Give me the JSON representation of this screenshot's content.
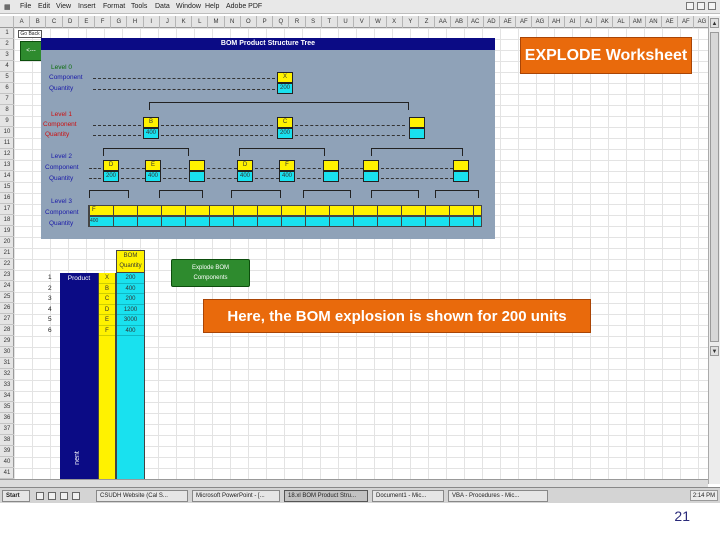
{
  "menubar": {
    "items": [
      "File",
      "Edit",
      "View",
      "Insert",
      "Format",
      "Tools",
      "Data",
      "Window",
      "Help",
      "Adobe PDF"
    ]
  },
  "columns": [
    "A",
    "B",
    "C",
    "D",
    "E",
    "F",
    "G",
    "H",
    "I",
    "J",
    "K",
    "L",
    "M",
    "N",
    "O",
    "P",
    "Q",
    "R",
    "S",
    "T",
    "U",
    "V",
    "W",
    "X",
    "Y",
    "Z",
    "AA",
    "AB",
    "AC",
    "AD",
    "AE",
    "AF",
    "AG",
    "AH",
    "AI",
    "AJ",
    "AK",
    "AL",
    "AM",
    "AN",
    "AE",
    "AF",
    "AG"
  ],
  "rows": [
    "1",
    "2",
    "3",
    "4",
    "5",
    "6",
    "7",
    "8",
    "9",
    "10",
    "11",
    "12",
    "13",
    "14",
    "15",
    "16",
    "17",
    "18",
    "19",
    "20",
    "21",
    "22",
    "23",
    "24",
    "25",
    "26",
    "27",
    "28",
    "29",
    "30",
    "31",
    "32",
    "33",
    "34",
    "35",
    "36",
    "37",
    "38",
    "39",
    "40",
    "41"
  ],
  "sheet": {
    "cell_ref": "Go Back",
    "back_button": "<---"
  },
  "bom_tree": {
    "title": "BOM Product Structure Tree",
    "level0": {
      "label": "Level 0",
      "component": "Component",
      "quantity": "Quantity",
      "comp_value": "X",
      "qty_value": "200"
    },
    "level1": {
      "label": "Level 1",
      "component": "Component",
      "quantity": "Quantity",
      "boxes": [
        {
          "comp": "B",
          "qty": "400"
        },
        {
          "comp": "C",
          "qty": "200"
        },
        {
          "comp": "",
          "qty": ""
        }
      ]
    },
    "level2": {
      "label": "Level 2",
      "component": "Component",
      "quantity": "Quantity",
      "boxes": [
        {
          "comp": "D",
          "qty": "200"
        },
        {
          "comp": "E",
          "qty": "400"
        },
        {
          "comp": "",
          "qty": ""
        },
        {
          "comp": "D",
          "qty": "400"
        },
        {
          "comp": "F",
          "qty": "400"
        },
        {
          "comp": "",
          "qty": ""
        },
        {
          "comp": "",
          "qty": ""
        },
        {
          "comp": "",
          "qty": ""
        }
      ]
    },
    "level3": {
      "label": "Level 3",
      "component": "Component",
      "quantity": "Quantity",
      "comp_first": "F",
      "qty_first": "400"
    }
  },
  "explode_button": {
    "line1": "Explode BOM",
    "line2": "Components"
  },
  "table": {
    "product_header": "Product",
    "product_rotated": "nent",
    "bom_header_l1": "BOM",
    "bom_header_l2": "Quantity",
    "row_numbers": [
      "1",
      "2",
      "3",
      "4",
      "5",
      "6"
    ],
    "components": [
      "X",
      "B",
      "C",
      "D",
      "E",
      "F"
    ],
    "quantities": [
      "200",
      "400",
      "200",
      "1200",
      "3000",
      "400"
    ]
  },
  "callouts": {
    "explode": "EXPLODE Worksheet",
    "explosion": "Here, the BOM explosion is shown for 200 units"
  },
  "taskbar": {
    "start": "Start",
    "tasks": [
      "CSUDH Website (Cal S...",
      "Microsoft PowerPoint - [...",
      "18.xl BOM Product Stru...",
      "Document1 - Mic...",
      "VBA - Procedures - Mic..."
    ],
    "tray": "2:14 PM"
  },
  "slide_number": "21",
  "colors": {
    "navy": "#0b0b85",
    "yellow": "#fff200",
    "cyan": "#19e1ef",
    "orange": "#e96a0c",
    "green": "#2e8b2e",
    "panel": "#8fa2b8"
  }
}
